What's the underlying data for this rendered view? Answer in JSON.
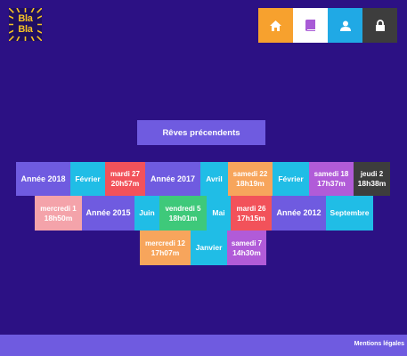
{
  "logo": {
    "line1": "Bla",
    "line2": "Bla"
  },
  "nav": {
    "home": {
      "icon": "home-icon",
      "color": "#f7a12e"
    },
    "book": {
      "icon": "book-icon",
      "color": "#ffffff",
      "icon_color": "#a85bd6"
    },
    "user": {
      "icon": "user-icon",
      "color": "#20a9e5"
    },
    "lock": {
      "icon": "lock-icon",
      "color": "#3d3d3d"
    }
  },
  "section_title": "Rêves précendents",
  "tiles": {
    "annee_2018": "Année 2018",
    "fevrier_1": "Février",
    "mardi_27": {
      "day": "mardi 27",
      "time": "20h57m"
    },
    "annee_2017": "Année 2017",
    "avril": "Avril",
    "samedi_22": {
      "day": "samedi 22",
      "time": "18h19m"
    },
    "fevrier_2": "Février",
    "samedi_18": {
      "day": "samedi 18",
      "time": "17h37m"
    },
    "jeudi_2": {
      "day": "jeudi 2",
      "time": "18h38m"
    },
    "mercredi_1": {
      "day": "mercredi 1",
      "time": "18h50m"
    },
    "annee_2015": "Année 2015",
    "juin": "Juin",
    "vendredi_5": {
      "day": "vendredi 5",
      "time": "18h01m"
    },
    "mai": "Mai",
    "mardi_26": {
      "day": "mardi 26",
      "time": "17h15m"
    },
    "annee_2012": "Année 2012",
    "septembre": "Septembre",
    "mercredi_12": {
      "day": "mercredi 12",
      "time": "17h07m"
    },
    "janvier": "Janvier",
    "samedi_7": {
      "day": "samedi 7",
      "time": "14h30m"
    }
  },
  "footer": {
    "link": "Mentions légales"
  },
  "colors": {
    "background": "#2c1184",
    "accent": "#6f5be0",
    "cyan": "#20bde6",
    "red": "#f2525a",
    "orange": "#f7a55c",
    "purple": "#b15bd8",
    "dark": "#3d3d3d",
    "pink": "#f4a3aa",
    "green": "#3ec97a"
  }
}
